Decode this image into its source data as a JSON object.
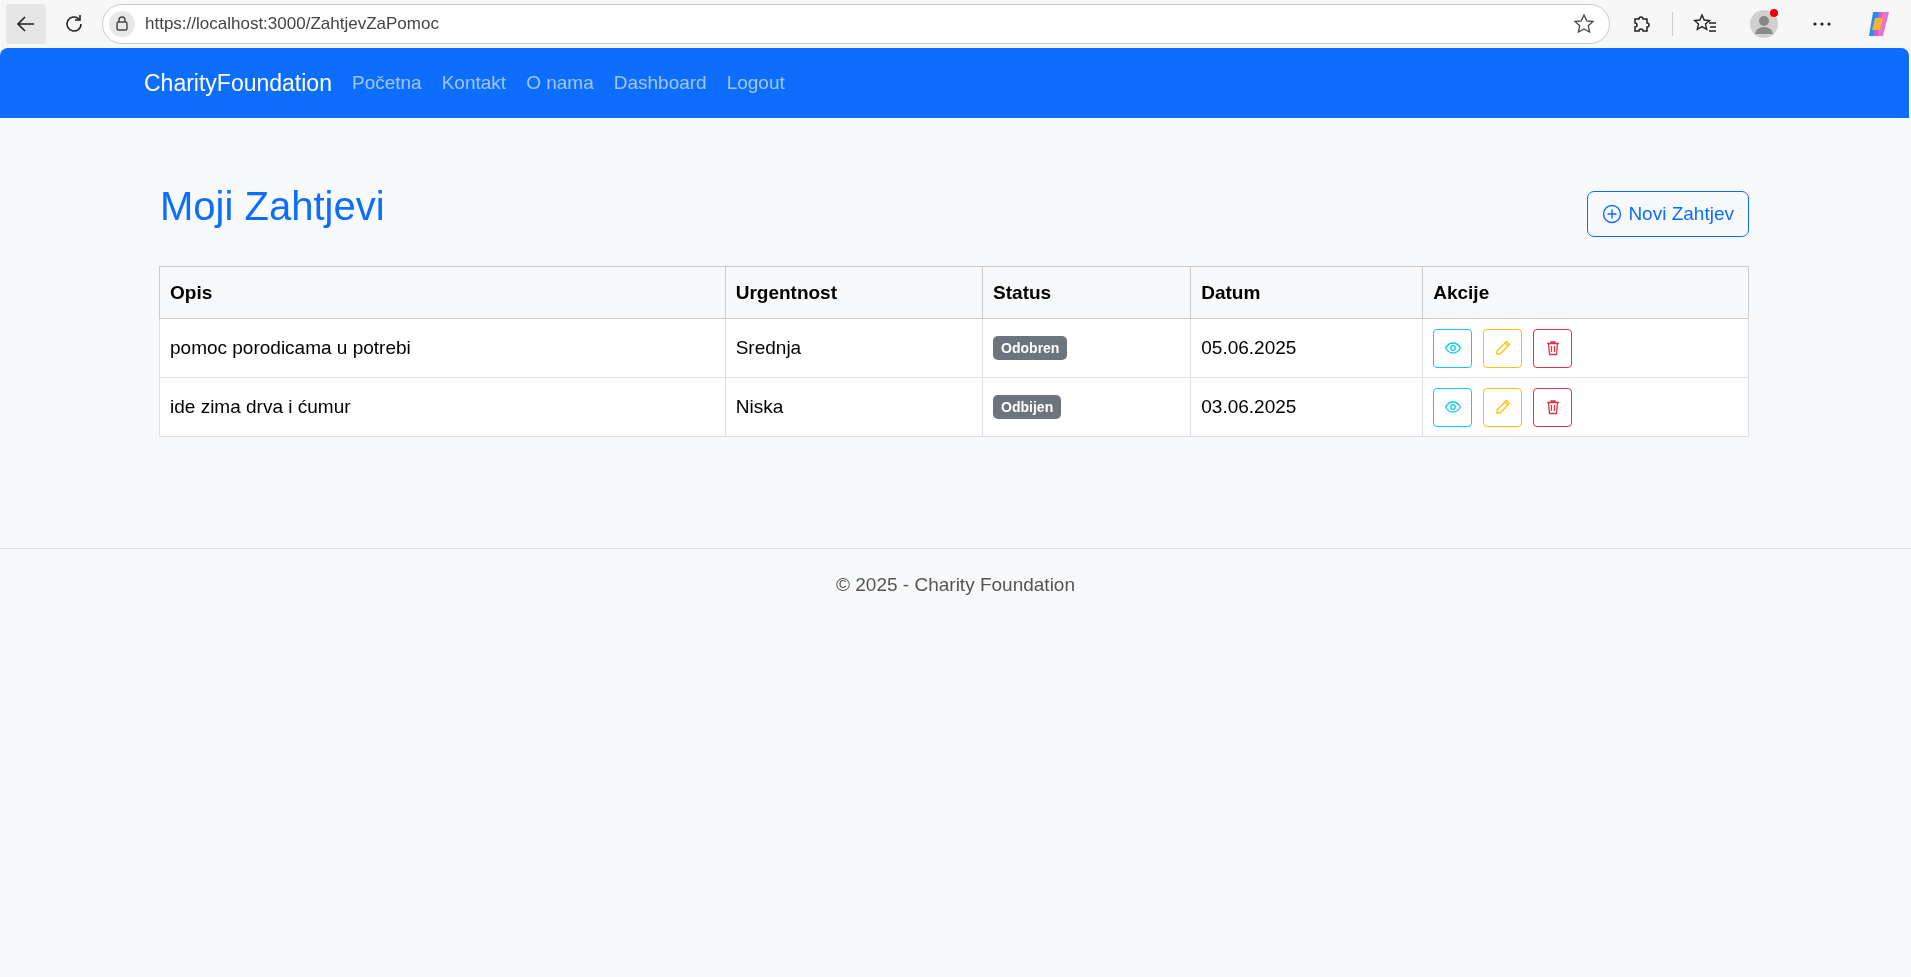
{
  "browser": {
    "url": "https://localhost:3000/ZahtjevZaPomoc"
  },
  "navbar": {
    "brand": "CharityFoundation",
    "links": [
      "Početna",
      "Kontakt",
      "O nama",
      "Dashboard",
      "Logout"
    ]
  },
  "page": {
    "title": "Moji Zahtjevi",
    "new_button": "Novi Zahtjev"
  },
  "table": {
    "columns": [
      "Opis",
      "Urgentnost",
      "Status",
      "Datum",
      "Akcije"
    ],
    "rows": [
      {
        "opis": "pomoc porodicama u potrebi",
        "urgentnost": "Srednja",
        "status": "Odobren",
        "datum": "05.06.2025"
      },
      {
        "opis": "ide zima drva i ćumur",
        "urgentnost": "Niska",
        "status": "Odbijen",
        "datum": "03.06.2025"
      }
    ]
  },
  "footer": "© 2025 - Charity Foundation"
}
